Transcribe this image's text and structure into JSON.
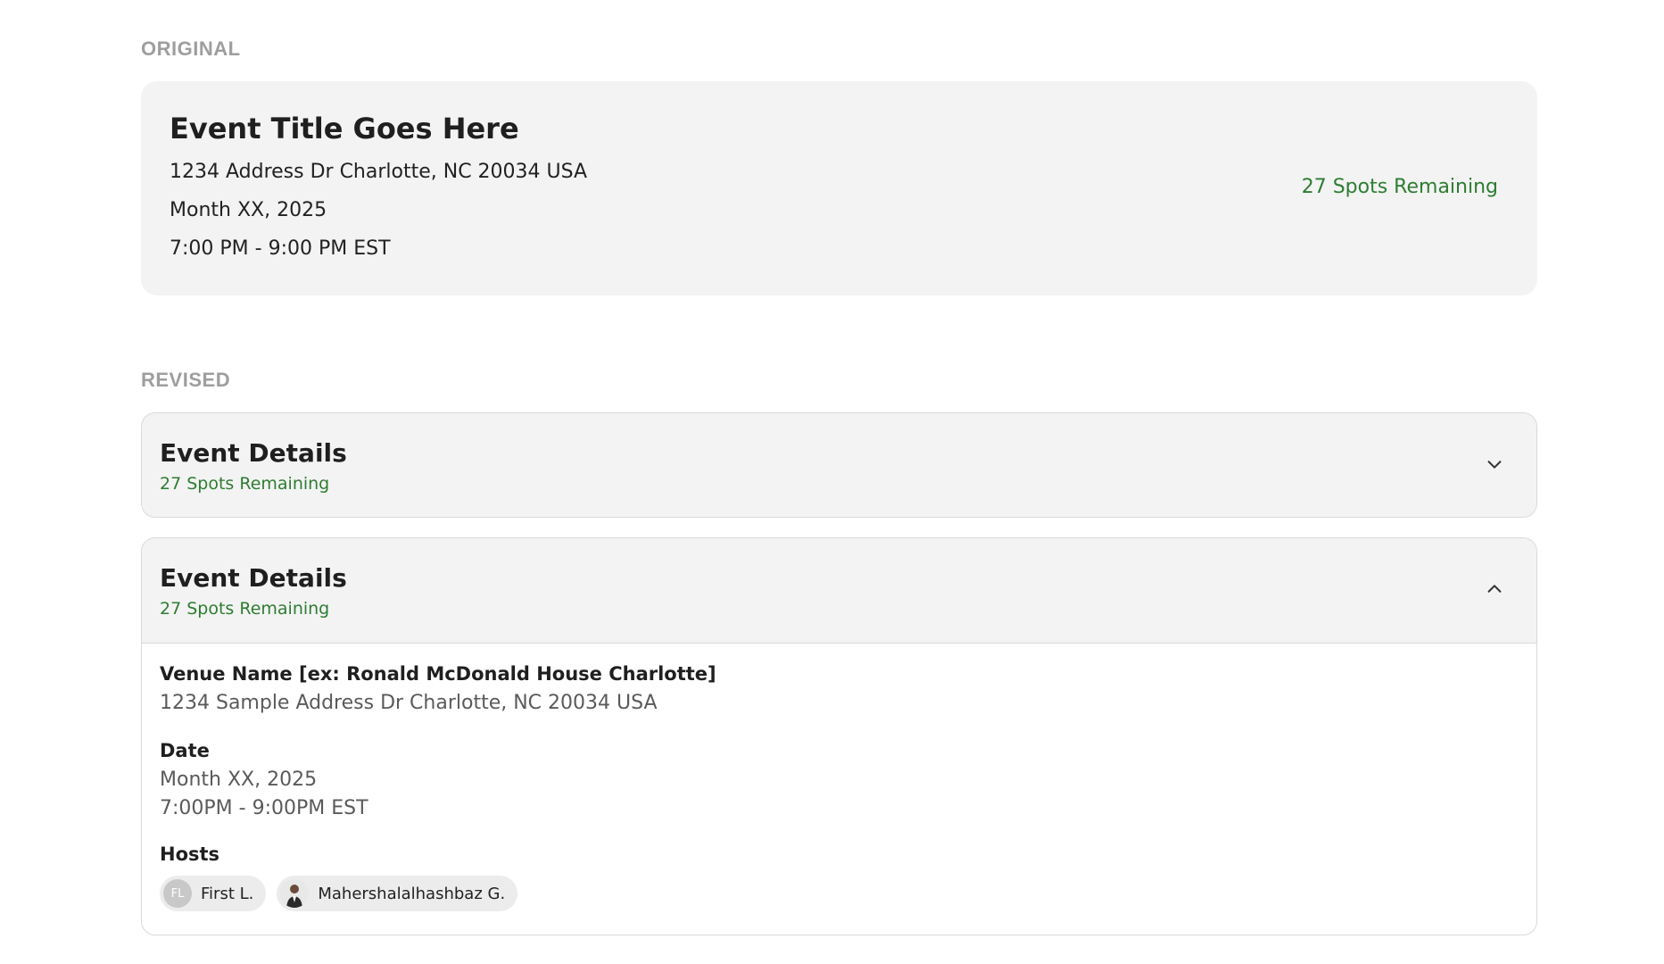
{
  "original": {
    "section_label": "ORIGINAL",
    "title": "Event Title Goes Here",
    "address": "1234 Address Dr Charlotte, NC 20034 USA",
    "date": "Month XX, 2025",
    "time": "7:00 PM - 9:00 PM EST",
    "spots": "27 Spots Remaining"
  },
  "revised": {
    "section_label": "REVISED",
    "collapsed": {
      "title": "Event Details",
      "spots": "27 Spots Remaining",
      "icon": "chevron-down-icon"
    },
    "expanded": {
      "title": "Event Details",
      "spots": "27 Spots Remaining",
      "icon": "chevron-up-icon",
      "venue_name": "Venue Name [ex: Ronald McDonald House Charlotte]",
      "venue_address": "1234 Sample Address Dr Charlotte, NC 20034 USA",
      "date_label": "Date",
      "date_value": "Month XX, 2025",
      "time_value": "7:00PM - 9:00PM EST",
      "hosts_label": "Hosts",
      "hosts": [
        {
          "initials": "FL",
          "name": "First L."
        },
        {
          "initials": "",
          "name": "Mahershalalhashbaz G."
        }
      ]
    }
  },
  "colors": {
    "accent_green": "#2e7d32",
    "card_bg": "#f3f3f3",
    "section_label": "#9e9e9e"
  }
}
